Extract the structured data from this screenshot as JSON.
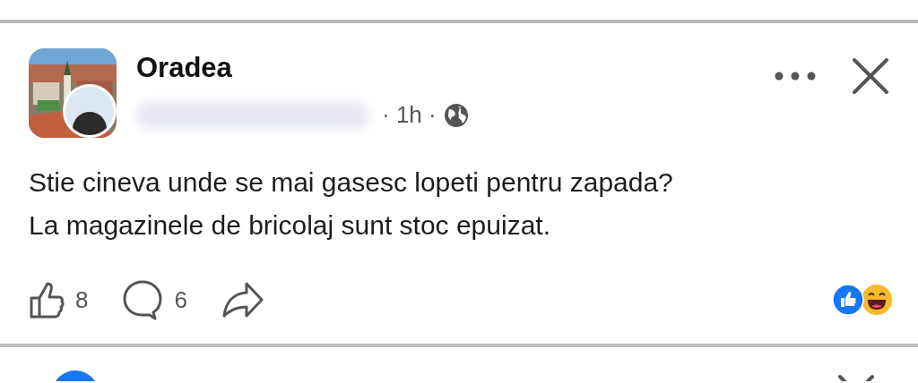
{
  "post": {
    "author": "Oradea",
    "time": "· 1h ·",
    "text_lines": [
      "Stie cineva unde se mai gasesc lopeti pentru zapada?",
      "La magazinele de bricolaj sunt stoc epuizat."
    ],
    "actions": [
      {
        "kind": "like",
        "count": "8"
      },
      {
        "kind": "comment",
        "count": "6"
      },
      {
        "kind": "share"
      }
    ],
    "reactions": [
      {
        "kind": "like",
        "color": "#1877f2"
      },
      {
        "kind": "haha",
        "color": "#f7b928"
      }
    ]
  }
}
